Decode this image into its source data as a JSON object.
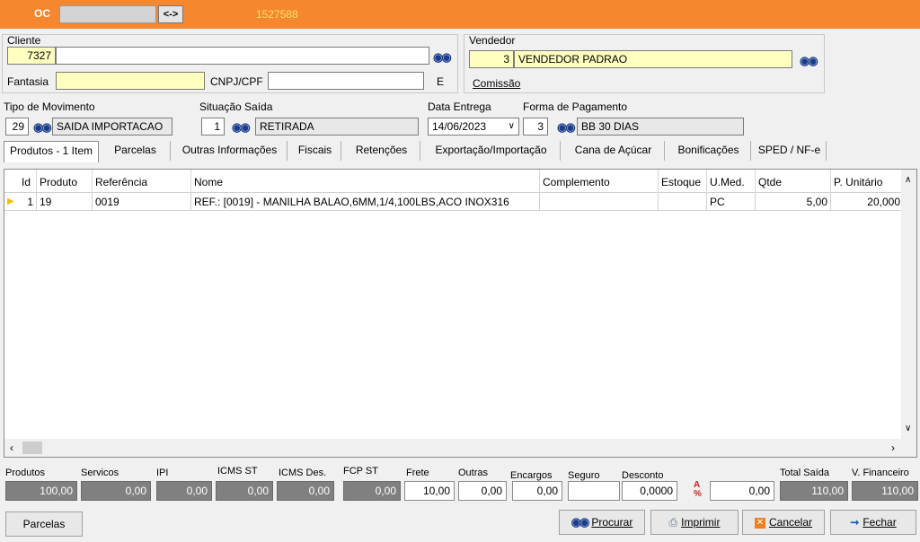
{
  "header": {
    "oc_label": "OC",
    "oc_value": "",
    "swap_label": "<->",
    "order_number": "1527588"
  },
  "cliente": {
    "label": "Cliente",
    "code": "7327",
    "name": "",
    "fantasia_label": "Fantasia",
    "fantasia_value": "",
    "cnpj_label": "CNPJ/CPF",
    "cnpj_value": "",
    "e_label": "E"
  },
  "vendedor": {
    "label": "Vendedor",
    "code": "3",
    "name": "VENDEDOR PADRAO",
    "comissao_label": "Comissão"
  },
  "tipo_movimento": {
    "label": "Tipo de Movimento",
    "code": "29",
    "name": "SAIDA IMPORTACAO"
  },
  "situacao_saida": {
    "label": "Situação Saída",
    "code": "1",
    "name": "RETIRADA"
  },
  "data_entrega": {
    "label": "Data Entrega",
    "value": "14/06/2023"
  },
  "forma_pagamento": {
    "label": "Forma de Pagamento",
    "code": "3",
    "name": "BB 30 DIAS"
  },
  "tabs": [
    "Produtos - 1 Item",
    "Parcelas",
    "Outras Informações",
    "Fiscais",
    "Retenções",
    "Exportação/Importação",
    "Cana de Açúcar",
    "Bonificações",
    "SPED / NF-e"
  ],
  "grid": {
    "columns": [
      "Id",
      "Produto",
      "Referência",
      "Nome",
      "Complemento",
      "Estoque",
      "U.Med.",
      "Qtde",
      "P. Unitário"
    ],
    "rows": [
      {
        "id": "1",
        "produto": "19",
        "referencia": "0019",
        "nome": "REF.: [0019] - MANILHA BALAO,6MM,1/4,100LBS,ACO INOX316",
        "complemento": "",
        "estoque": "",
        "umed": "PC",
        "qtde": "5,00",
        "punit": "20,000"
      }
    ]
  },
  "totals": {
    "produtos": {
      "label": "Produtos",
      "value": "100,00"
    },
    "servicos": {
      "label": "Servicos",
      "value": "0,00"
    },
    "ipi": {
      "label": "IPI",
      "value": "0,00"
    },
    "icms_st": {
      "label": "ICMS ST",
      "value": "0,00"
    },
    "icms_des": {
      "label": "ICMS Des.",
      "value": "0,00"
    },
    "fcp_st": {
      "label": "FCP ST",
      "value": "0,00"
    },
    "frete": {
      "label": "Frete",
      "value": "10,00"
    },
    "outras": {
      "label": "Outras",
      "value": "0,00"
    },
    "encargos": {
      "label": "Encargos",
      "value": "0,00"
    },
    "seguro": {
      "label": "Seguro",
      "value": ""
    },
    "desconto": {
      "label": "Desconto",
      "value": "0,0000",
      "value2": "0,00"
    },
    "total_saida": {
      "label": "Total Saída",
      "value": "110,00"
    },
    "v_financeiro": {
      "label": "V. Financeiro",
      "value": "110,00"
    }
  },
  "buttons": {
    "parcelas": "Parcelas",
    "procurar": "Procurar",
    "imprimir": "Imprimir",
    "cancelar": "Cancelar",
    "fechar": "Fechar"
  },
  "colors": {
    "accent": "#f5882f",
    "order_number": "#ffe066",
    "highlight_field": "#ffffc0"
  }
}
